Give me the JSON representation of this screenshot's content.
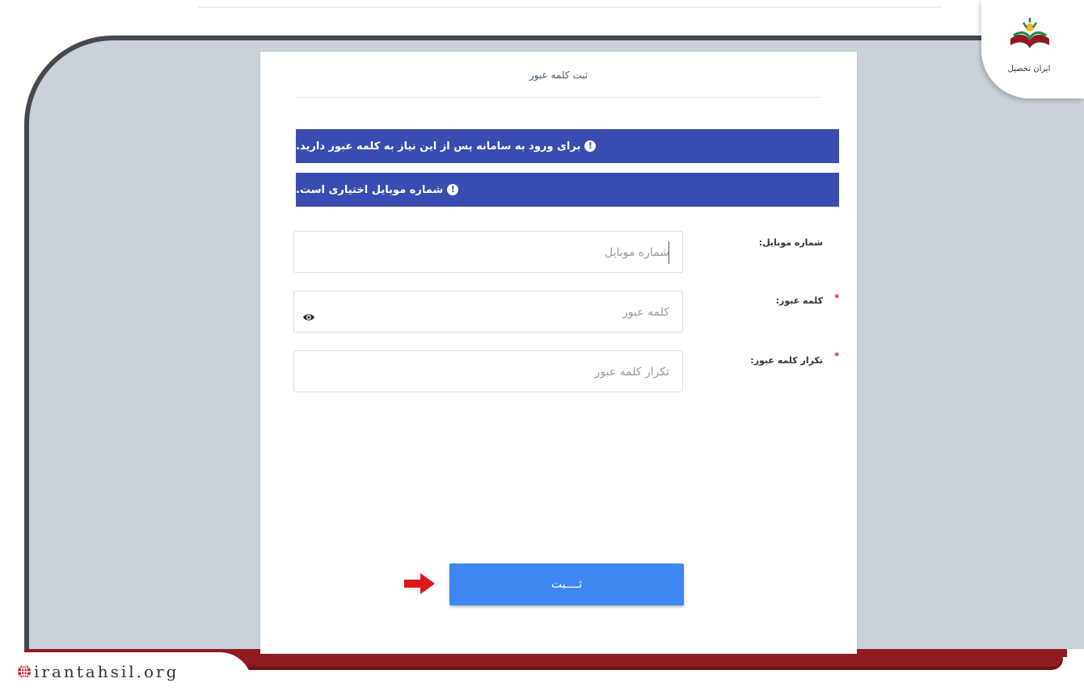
{
  "dialog": {
    "title": "ثبت کلمه عبور"
  },
  "banners": [
    {
      "text": "برای ورود به سامانه پس از این نیاز به کلمه عبور دارید."
    },
    {
      "text": "شماره موبایل اختیاری است."
    }
  ],
  "form": {
    "mobile": {
      "label": "شماره موبایل:",
      "placeholder": "شماره موبایل"
    },
    "password": {
      "label": "کلمه عبور:",
      "placeholder": "کلمه عبور",
      "required_mark": "*"
    },
    "password_repeat": {
      "label": "تکرار کلمه عبور:",
      "placeholder": "تکرار کلمه عبور",
      "required_mark": "*"
    },
    "submit_label": "ثــــبت"
  },
  "branding": {
    "logo_text": "ایران تحصیل",
    "site": "irantahsil.org"
  },
  "colors": {
    "banner": "#3b4cb0",
    "button": "#3f87f0",
    "required": "#d9262c",
    "arrow": "#e0161d",
    "frame_accent": "#8f1b22"
  },
  "icons": [
    "info-icon",
    "eye-icon",
    "arrow-right-icon",
    "globe-icon",
    "book-logo-icon"
  ]
}
